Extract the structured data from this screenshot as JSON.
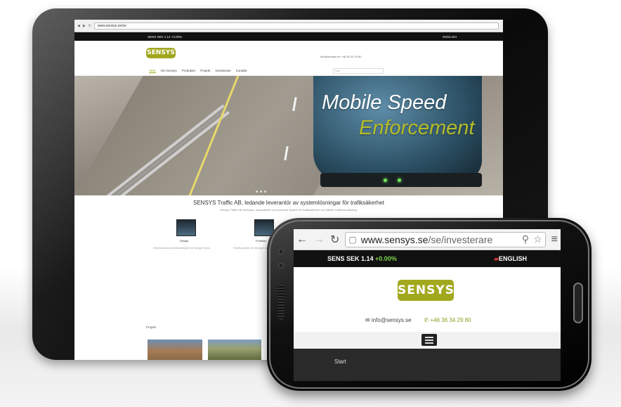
{
  "tablet": {
    "browser": {
      "url": "www.sensys.se/se"
    },
    "ticker": {
      "stock": "SENS SEK 1.14 +0.00%",
      "language": "ENGLISH"
    },
    "logo_text": "SENSYS",
    "contact": "info@sensys.se   +46 36 34 29 80",
    "nav": [
      "Start",
      "Om Sensys",
      "Produkter",
      "Projekt",
      "Investerare",
      "Kontakt"
    ],
    "search_placeholder": "Sök",
    "hero": {
      "line1": "Mobile Speed",
      "line2": "Enforcement"
    },
    "headline": "SENSYS Traffic AB, ledande leverantör av systemlösningar för trafiksäkerhet",
    "intro": "Sensys Traffic AB utvecklar, marknadsför och levererar system för trafiksäkerhet och effektiv trafikövervakning.",
    "cards": [
      {
        "label": "Design",
        "text": "Utvecklat med användarvänlighet och design i fokus."
      },
      {
        "label": "Funktion",
        "text": "Flexibla system för alla typer av trafikövervakning."
      }
    ],
    "projects_label": "Projekt"
  },
  "phone": {
    "browser": {
      "domain": "www.sensys.se",
      "path": "/se/investerare"
    },
    "ticker": {
      "prefix": "SENS SEK 1.14",
      "change": "+0.00%",
      "language": "ENGLISH"
    },
    "logo_text": "SENSYS",
    "contact": {
      "email": "info@sensys.se",
      "phone": "+46 36 34 29 80"
    },
    "menu": {
      "start": "Start"
    }
  },
  "colors": {
    "brand": "#a2a81e",
    "stock_up": "#7cd34a",
    "hero_accent": "#b5bd2a"
  }
}
